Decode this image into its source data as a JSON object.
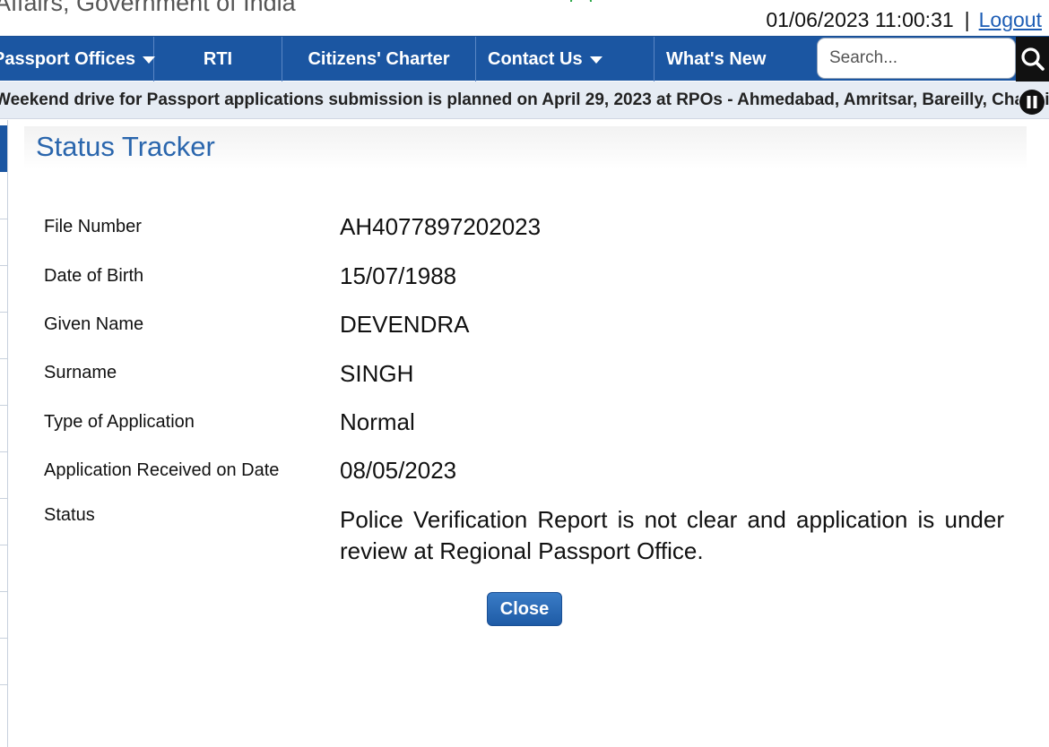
{
  "header": {
    "ministry_text": "Affairs, Government of India",
    "datetime": "01/06/2023 11:00:31",
    "separator": "|",
    "logout_label": "Logout"
  },
  "nav": {
    "passport_offices": "Passport Offices",
    "rti": "RTI",
    "citizens_charter": "Citizens' Charter",
    "contact_us": "Contact Us",
    "whats_new": "What's New",
    "search_placeholder": "Search..."
  },
  "ticker": {
    "text": "Weekend drive for Passport applications submission is planned on April 29, 2023 at RPOs - Ahmedabad, Amritsar, Bareilly, Chandigarh"
  },
  "tracker": {
    "title": "Status Tracker",
    "fields": [
      {
        "label": "File Number",
        "value": "AH4077897202023"
      },
      {
        "label": "Date of Birth",
        "value": "15/07/1988"
      },
      {
        "label": "Given Name",
        "value": "DEVENDRA"
      },
      {
        "label": "Surname",
        "value": "SINGH"
      },
      {
        "label": "Type of Application",
        "value": "Normal"
      },
      {
        "label": "Application Received on Date",
        "value": "08/05/2023"
      },
      {
        "label": "Status",
        "value": "Police Verification Report is not clear and application is under review at Regional Passport Office."
      }
    ],
    "close_label": "Close"
  },
  "colors": {
    "nav_blue": "#1b56a2",
    "title_blue": "#2a66ad",
    "link_blue": "#1d5db5",
    "online_green": "#2ea84a"
  }
}
